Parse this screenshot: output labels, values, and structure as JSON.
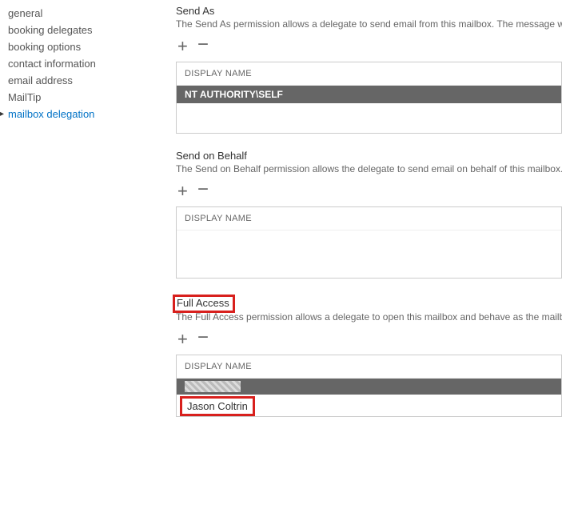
{
  "sidebar": {
    "items": [
      {
        "label": "general"
      },
      {
        "label": "booking delegates"
      },
      {
        "label": "booking options"
      },
      {
        "label": "contact information"
      },
      {
        "label": "email address"
      },
      {
        "label": "MailTip"
      },
      {
        "label": "mailbox delegation"
      }
    ]
  },
  "sections": {
    "sendAs": {
      "title": "Send As",
      "desc": "The Send As permission allows a delegate to send email from this mailbox. The message will ap",
      "header": "DISPLAY NAME",
      "rows": [
        "NT AUTHORITY\\SELF"
      ]
    },
    "sendOnBehalf": {
      "title": "Send on Behalf",
      "desc": "The Send on Behalf permission allows the delegate to send email on behalf of this mailbox. The",
      "header": "DISPLAY NAME"
    },
    "fullAccess": {
      "title": "Full Access",
      "desc": "The Full Access permission allows a delegate to open this mailbox and behave as the mailbox o",
      "header": "DISPLAY NAME",
      "userRow": "Jason Coltrin"
    }
  }
}
